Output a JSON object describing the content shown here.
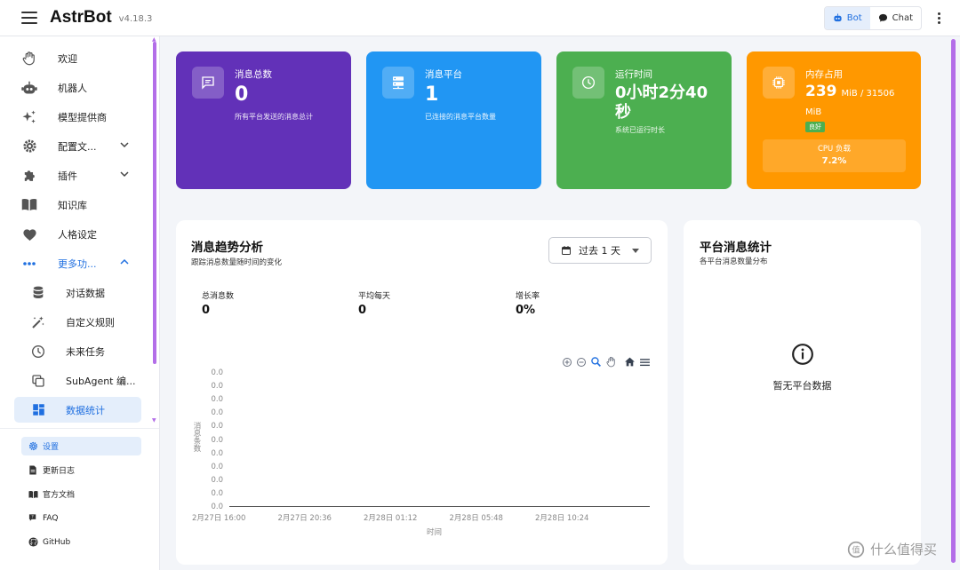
{
  "app": {
    "title": "AstrBot",
    "version": "v4.18.3"
  },
  "header": {
    "bot_label": "Bot",
    "chat_label": "Chat"
  },
  "sidebar": {
    "items": [
      {
        "label": "欢迎",
        "icon": "hand-wave-icon"
      },
      {
        "label": "机器人",
        "icon": "robot-icon"
      },
      {
        "label": "模型提供商",
        "icon": "sparkles-icon"
      },
      {
        "label": "配置文...",
        "icon": "gear-icon"
      },
      {
        "label": "插件",
        "icon": "puzzle-icon"
      },
      {
        "label": "知识库",
        "icon": "book-icon"
      },
      {
        "label": "人格设定",
        "icon": "heart-icon"
      },
      {
        "label": "更多功...",
        "icon": "dots-icon"
      },
      {
        "label": "对话数据",
        "icon": "database-icon"
      },
      {
        "label": "自定义规则",
        "icon": "magic-wand-icon"
      },
      {
        "label": "未来任务",
        "icon": "clock-icon"
      },
      {
        "label": "SubAgent 编...",
        "icon": "copy-icon"
      },
      {
        "label": "数据统计",
        "icon": "dashboard-icon"
      }
    ],
    "footer": [
      {
        "label": "设置",
        "icon": "gear-icon"
      },
      {
        "label": "更新日志",
        "icon": "document-icon"
      },
      {
        "label": "官方文档",
        "icon": "book-icon"
      },
      {
        "label": "FAQ",
        "icon": "question-icon"
      },
      {
        "label": "GitHub",
        "icon": "github-icon"
      }
    ]
  },
  "stats": [
    {
      "title": "消息总数",
      "value": "0",
      "desc": "所有平台发送的消息总计",
      "color": "#6231b8"
    },
    {
      "title": "消息平台",
      "value": "1",
      "desc": "已连接的消息平台数量",
      "color": "#2196f3"
    },
    {
      "title": "运行时间",
      "value_line1": "0小时2分40",
      "value_line2": "秒",
      "desc": "系统已运行时长",
      "color": "#4caf50"
    },
    {
      "title": "内存占用",
      "value": "239",
      "unit": "MiB / 31506",
      "unit2": "MiB",
      "badge": "良好",
      "cpu_label": "CPU 负载",
      "cpu_value": "7.2%",
      "color": "#ff9800"
    }
  ],
  "trend": {
    "title": "消息趋势分析",
    "subtitle": "跟踪消息数量随时间的变化",
    "range": "过去 1 天",
    "metrics": [
      {
        "label": "总消息数",
        "value": "0"
      },
      {
        "label": "平均每天",
        "value": "0"
      },
      {
        "label": "增长率",
        "value": "0%"
      }
    ]
  },
  "chart_data": {
    "type": "line",
    "x": [
      "2月27日 16:00",
      "2月27日 20:36",
      "2月28日 01:12",
      "2月28日 05:48",
      "2月28日 10:24"
    ],
    "yticks": [
      "0.0",
      "0.0",
      "0.0",
      "0.0",
      "0.0",
      "0.0",
      "0.0",
      "0.0",
      "0.0",
      "0.0",
      "0.0"
    ],
    "xlabel": "时间",
    "ylabel": "消息条数",
    "series": []
  },
  "platform": {
    "title": "平台消息统计",
    "subtitle": "各平台消息数量分布",
    "empty": "暂无平台数据"
  },
  "watermark": "什么值得买"
}
